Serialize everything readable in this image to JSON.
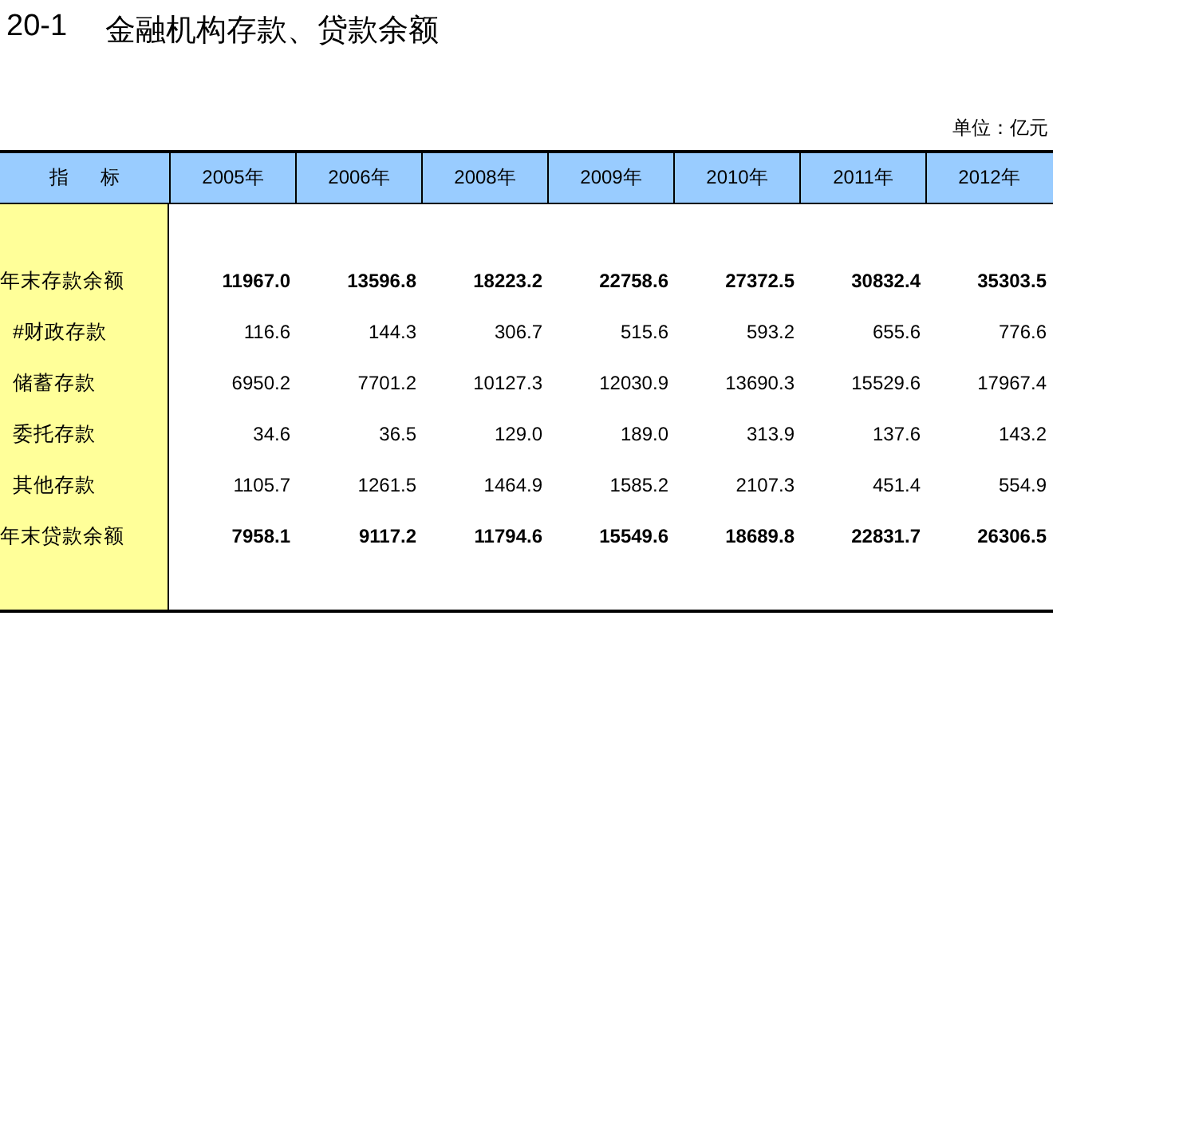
{
  "title": {
    "number": "20-1",
    "text": "金融机构存款、贷款余额"
  },
  "unit": "单位：亿元",
  "table": {
    "corner": "指      标",
    "columns": [
      "2005年",
      "2006年",
      "2008年",
      "2009年",
      "2010年",
      "2011年",
      "2012年"
    ],
    "rows": [
      {
        "kind": "total",
        "label": "年末存款余额",
        "values": [
          "11967.0",
          "13596.8",
          "18223.2",
          "22758.6",
          "27372.5",
          "30832.4",
          "35303.5"
        ]
      },
      {
        "kind": "item",
        "label": "#财政存款",
        "values": [
          "116.6",
          "144.3",
          "306.7",
          "515.6",
          "593.2",
          "655.6",
          "776.6"
        ]
      },
      {
        "kind": "item",
        "label": "储蓄存款",
        "values": [
          "6950.2",
          "7701.2",
          "10127.3",
          "12030.9",
          "13690.3",
          "15529.6",
          "17967.4"
        ]
      },
      {
        "kind": "item",
        "label": "委托存款",
        "values": [
          "34.6",
          "36.5",
          "129.0",
          "189.0",
          "313.9",
          "137.6",
          "143.2"
        ]
      },
      {
        "kind": "item",
        "label": "其他存款",
        "values": [
          "1105.7",
          "1261.5",
          "1464.9",
          "1585.2",
          "2107.3",
          "451.4",
          "554.9"
        ]
      },
      {
        "kind": "total",
        "label": "年末贷款余额",
        "values": [
          "7958.1",
          "9117.2",
          "11794.6",
          "15549.6",
          "18689.8",
          "22831.7",
          "26306.5"
        ]
      }
    ]
  }
}
